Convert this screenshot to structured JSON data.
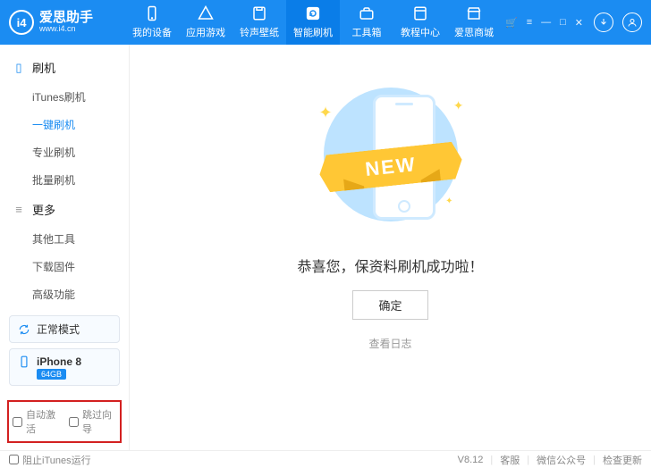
{
  "app": {
    "name": "爱思助手",
    "url": "www.i4.cn",
    "logo_text": "i4"
  },
  "nav": [
    {
      "label": "我的设备",
      "icon": "phone"
    },
    {
      "label": "应用游戏",
      "icon": "apps"
    },
    {
      "label": "铃声壁纸",
      "icon": "music"
    },
    {
      "label": "智能刷机",
      "icon": "refresh",
      "active": true
    },
    {
      "label": "工具箱",
      "icon": "toolbox"
    },
    {
      "label": "教程中心",
      "icon": "book"
    },
    {
      "label": "爱思商城",
      "icon": "shop"
    }
  ],
  "sidebar": {
    "section1": {
      "title": "刷机",
      "items": [
        "iTunes刷机",
        "一键刷机",
        "专业刷机",
        "批量刷机"
      ],
      "active_index": 1
    },
    "section2": {
      "title": "更多",
      "items": [
        "其他工具",
        "下载固件",
        "高级功能"
      ]
    },
    "mode_normal": "正常模式",
    "device": {
      "name": "iPhone 8",
      "storage": "64GB"
    },
    "auto_activate": "自动激活",
    "skip_guide": "跳过向导"
  },
  "main": {
    "ribbon": "NEW",
    "message": "恭喜您，保资料刷机成功啦！",
    "ok": "确定",
    "view_log": "查看日志"
  },
  "footer": {
    "block_itunes": "阻止iTunes运行",
    "version": "V8.12",
    "support": "客服",
    "wechat": "微信公众号",
    "update": "检查更新"
  }
}
